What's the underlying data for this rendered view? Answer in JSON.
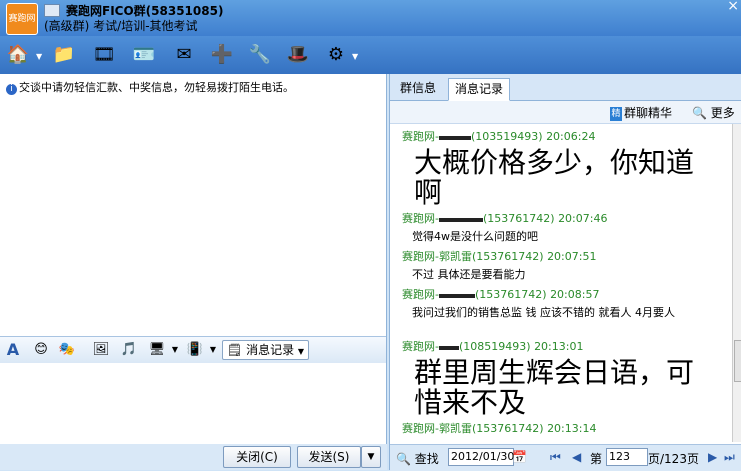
{
  "window": {
    "title": "赛跑网FICO群(58351085)",
    "subtitle": "(高级群) 考试/培训-其他考试",
    "logo_text": "赛跑网",
    "close": "×"
  },
  "toolbar": {
    "icons": [
      "home-icon",
      "folder-icon",
      "film-icon",
      "card-icon",
      "mail-icon",
      "add-app-icon",
      "tools-icon",
      "hat-icon",
      "gear-icon"
    ]
  },
  "notice": {
    "text": "交谈中请勿轻信汇款、中奖信息，勿轻易拨打陌生电话。"
  },
  "input_toolbar": {
    "history_label": "消息记录"
  },
  "buttons": {
    "close": "关闭(C)",
    "send": "发送(S)"
  },
  "tabs": [
    {
      "label": "群信息"
    },
    {
      "label": "消息记录"
    }
  ],
  "subbar": {
    "essence": "群聊精华",
    "more": "更多"
  },
  "messages": [
    {
      "sender": "赛跑网-",
      "id": "(103519493)",
      "time": "20:06:24",
      "text": "大概价格多少，你知道啊",
      "big": true
    },
    {
      "sender": "赛跑网-",
      "id": "(153761742)",
      "time": "20:07:46",
      "text": "觉得4w是没什么问题的吧",
      "big": false
    },
    {
      "sender": "赛跑网-郭凯雷",
      "id": "(153761742)",
      "time": "20:07:51",
      "text": "不过 具体还是要看能力",
      "big": false
    },
    {
      "sender": "赛跑网-",
      "id": "(153761742)",
      "time": "20:08:57",
      "text": "我问过我们的销售总监 钱 应该不错的 就看人 4月要人",
      "big": false
    },
    {
      "sender": "赛跑网-",
      "id": "(108519493)",
      "time": "20:13:01",
      "text": "群里周生辉会日语，可惜来不及",
      "big": true
    },
    {
      "sender": "赛跑网-郭凯雷",
      "id": "(153761742)",
      "time": "20:13:14",
      "text": "",
      "big": false
    }
  ],
  "pager": {
    "search": "查找",
    "date": "2012/01/30",
    "page_prefix": "第",
    "page": "123",
    "page_suffix": "页/123页"
  }
}
